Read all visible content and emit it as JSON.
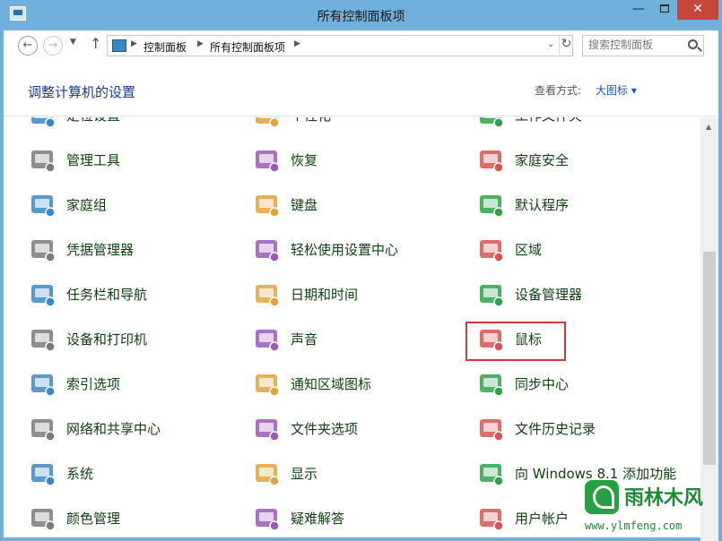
{
  "window": {
    "title": "所有控制面板项",
    "controls": {
      "minimize": "—",
      "close": "✕"
    }
  },
  "address": {
    "breadcrumb": [
      "控制面板",
      "所有控制面板项"
    ],
    "search_placeholder": "搜索控制面板"
  },
  "header": {
    "title": "调整计算机的设置",
    "view_label": "查看方式:",
    "view_value": "大图标 ▾"
  },
  "items": [
    {
      "label": "定位设置",
      "icon": "location-settings-icon"
    },
    {
      "label": "个性化",
      "icon": "personalization-icon"
    },
    {
      "label": "工作文件夹",
      "icon": "work-folders-icon"
    },
    {
      "label": "管理工具",
      "icon": "admin-tools-icon"
    },
    {
      "label": "恢复",
      "icon": "recovery-icon"
    },
    {
      "label": "家庭安全",
      "icon": "family-safety-icon"
    },
    {
      "label": "家庭组",
      "icon": "homegroup-icon"
    },
    {
      "label": "键盘",
      "icon": "keyboard-icon"
    },
    {
      "label": "默认程序",
      "icon": "default-programs-icon"
    },
    {
      "label": "凭据管理器",
      "icon": "credential-manager-icon"
    },
    {
      "label": "轻松使用设置中心",
      "icon": "ease-of-access-icon"
    },
    {
      "label": "区域",
      "icon": "region-icon"
    },
    {
      "label": "任务栏和导航",
      "icon": "taskbar-icon"
    },
    {
      "label": "日期和时间",
      "icon": "date-time-icon"
    },
    {
      "label": "设备管理器",
      "icon": "device-manager-icon"
    },
    {
      "label": "设备和打印机",
      "icon": "devices-printers-icon"
    },
    {
      "label": "声音",
      "icon": "sound-icon"
    },
    {
      "label": "鼠标",
      "icon": "mouse-icon"
    },
    {
      "label": "索引选项",
      "icon": "indexing-icon"
    },
    {
      "label": "通知区域图标",
      "icon": "notification-area-icon"
    },
    {
      "label": "同步中心",
      "icon": "sync-center-icon"
    },
    {
      "label": "网络和共享中心",
      "icon": "network-icon"
    },
    {
      "label": "文件夹选项",
      "icon": "folder-options-icon"
    },
    {
      "label": "文件历史记录",
      "icon": "file-history-icon"
    },
    {
      "label": "系统",
      "icon": "system-icon"
    },
    {
      "label": "显示",
      "icon": "display-icon"
    },
    {
      "label": "向 Windows 8.1 添加功能",
      "icon": "add-features-icon"
    },
    {
      "label": "颜色管理",
      "icon": "color-management-icon"
    },
    {
      "label": "疑难解答",
      "icon": "troubleshooting-icon"
    },
    {
      "label": "用户帐户",
      "icon": "user-accounts-icon"
    }
  ],
  "highlighted_item": "鼠标",
  "watermark": {
    "name": "雨林木风",
    "url": "www.ylmfeng.com"
  },
  "colors": {
    "titlebar": "#6fb0dc",
    "link": "#1e56b5",
    "item_text": "#0f3f0f",
    "highlight_border": "#d23a3a"
  }
}
